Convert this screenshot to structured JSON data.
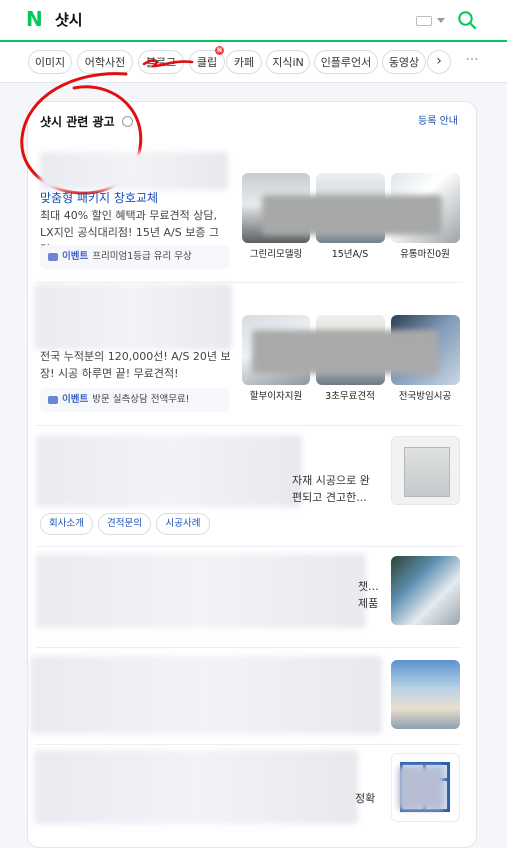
{
  "header": {
    "logo": "N",
    "query": "샷시",
    "keyboard_icon": "keyboard-icon",
    "search_icon": "search-icon"
  },
  "tabs": [
    {
      "label": "이미지"
    },
    {
      "label": "어학사전"
    },
    {
      "label": "블로그"
    },
    {
      "label": "클립",
      "badge": "N"
    },
    {
      "label": "카페"
    },
    {
      "label": "지식iN"
    },
    {
      "label": "인플루언서"
    },
    {
      "label": "동영상"
    }
  ],
  "tab_next": "›",
  "tab_more": "···",
  "ads_section": {
    "title": "샷시 관련 광고",
    "register": "등록 안내"
  },
  "ads": [
    {
      "link": "맞춤형 패키지 창호교체",
      "desc": "최대 40% 할인 혜택과 무료견적 상담, LX지인 공식대리점! 15년 A/S 보증 그린...",
      "event_label": "이벤트",
      "event_text": "프리미엄1등급 유리 무상",
      "thumbs": [
        "그린리모델링",
        "15년A/S",
        "유통마진0원"
      ]
    },
    {
      "desc": "전국 누적분의 120,000선! A/S 20년 보장! 시공 하루면 끝! 무료견적!",
      "event_label": "이벤트",
      "event_text": "방문 실측상담 전액무료!",
      "thumbs": [
        "할부이자지원",
        "3초무료견적",
        "전국방임시공"
      ]
    },
    {
      "fragment1": "자재 시공으로 완",
      "fragment2": "편되고 견고한...",
      "chips": [
        "회사소개",
        "견적문의",
        "시공사례"
      ]
    },
    {
      "fragment1": "챗...",
      "fragment2": "제품"
    },
    {
      "fragment1": ""
    },
    {
      "fragment1": "정확"
    }
  ],
  "colors": {
    "brand": "#03c75a",
    "link": "#1a4fb4",
    "badge": "#f04040"
  }
}
